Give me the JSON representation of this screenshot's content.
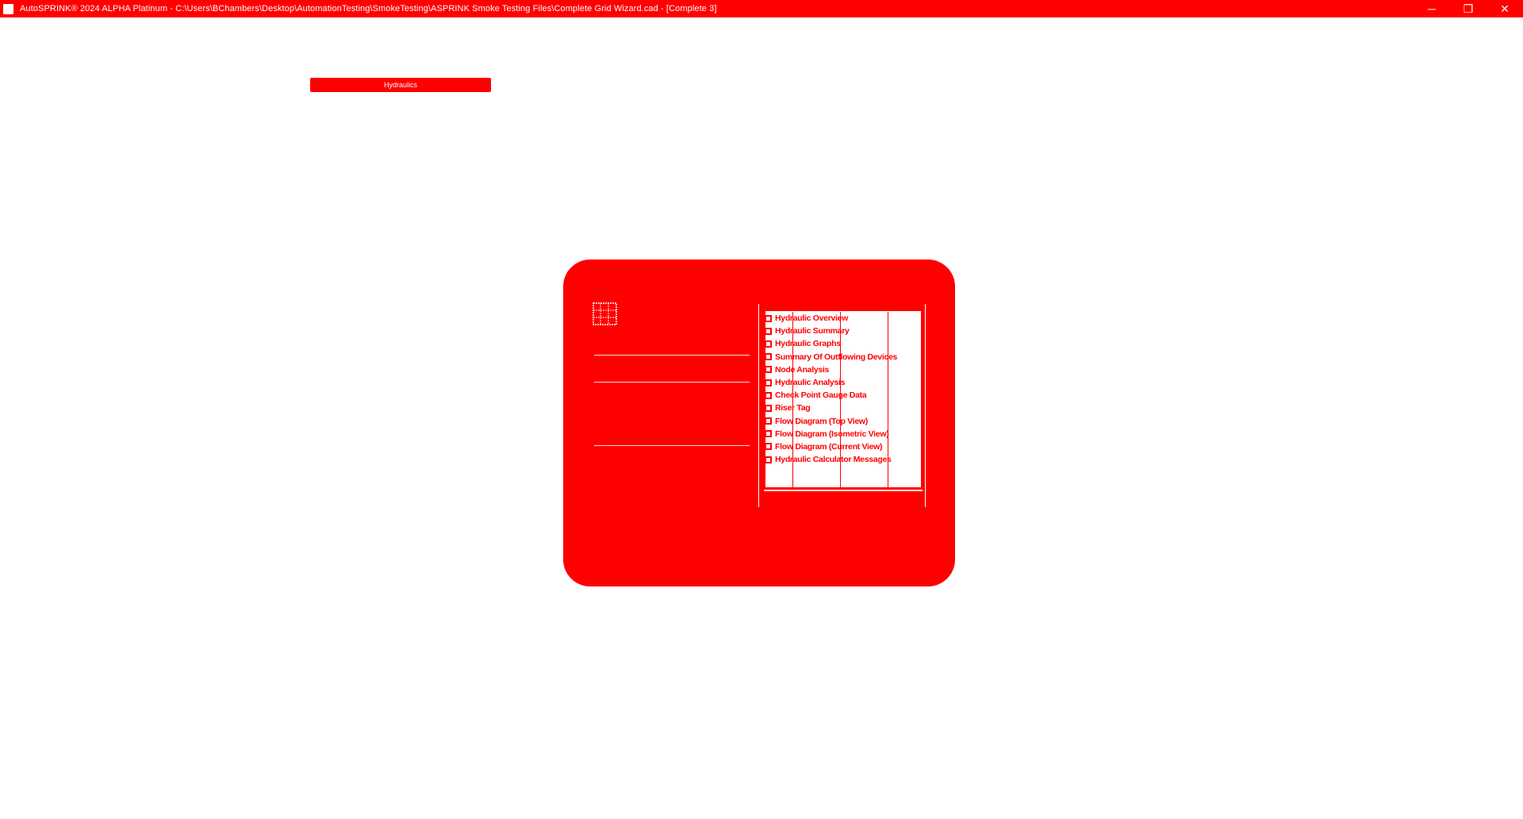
{
  "window": {
    "title": "AutoSPRINK® 2024 ALPHA Platinum - C:\\Users\\BChambers\\Desktop\\AutomationTesting\\SmokeTesting\\ASPRINK Smoke Testing Files\\Complete Grid Wizard.cad - [Complete 3]",
    "minimize_glyph": "─",
    "restore_glyph": "❐",
    "close_glyph": "✕"
  },
  "ghost_tab": {
    "label": "Hydraulics"
  },
  "dialog": {
    "icon": "grid-icon",
    "reports": [
      {
        "label": "Hydraulic Overview",
        "checked": false
      },
      {
        "label": "Hydraulic Summary",
        "checked": false
      },
      {
        "label": "Hydraulic Graphs",
        "checked": false
      },
      {
        "label": "Summary Of Outflowing Devices",
        "checked": false
      },
      {
        "label": "Node Analysis",
        "checked": false
      },
      {
        "label": "Hydraulic Analysis",
        "checked": false
      },
      {
        "label": "Check Point Gauge Data",
        "checked": false
      },
      {
        "label": "Riser Tag",
        "checked": false
      },
      {
        "label": "Flow Diagram (Top View)",
        "checked": false
      },
      {
        "label": "Flow Diagram (Isometric View)",
        "checked": false
      },
      {
        "label": "Flow Diagram (Current View)",
        "checked": false
      },
      {
        "label": "Hydraulic Calculator Messages",
        "checked": false
      }
    ]
  },
  "colors": {
    "accent": "#ff0000",
    "background": "#ffffff"
  }
}
